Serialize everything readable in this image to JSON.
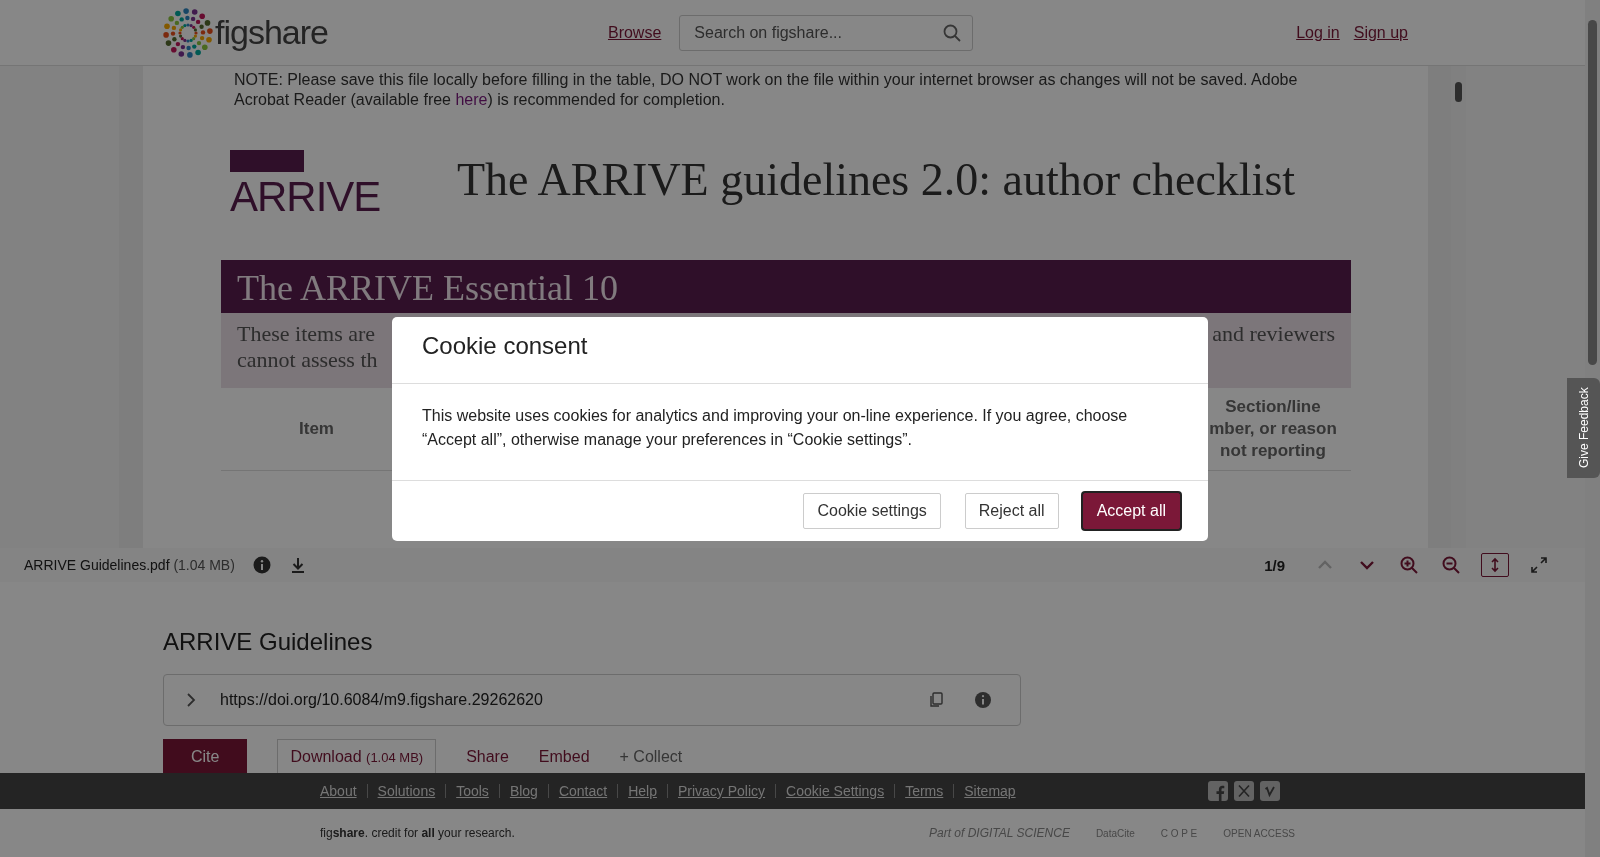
{
  "header": {
    "logo": "figshare",
    "nav_link": "Browse",
    "search": {
      "placeholder": "Search on figshare..."
    },
    "auth_links": [
      "Log in",
      "Sign up"
    ]
  },
  "viewer": {
    "document": {
      "note_before": "NOTE: Please save this file locally before filling in the table, DO NOT work on the file within your internet browser as changes will not be saved. Adobe Acrobat Reader (available free ",
      "note_link": "here",
      "note_after": ") is recommended for completion.",
      "logo": "ARRIVE",
      "title": "The ARRIVE guidelines 2.0: author checklist",
      "banner": "The ARRIVE Essential 10",
      "band_left": "These items are",
      "band_right": "and reviewers",
      "band_line2": "cannot assess th",
      "column_1": "Item",
      "column_last": [
        "Section/line",
        "mber, or reason",
        "not reporting"
      ]
    },
    "toolbar": {
      "file_name": "ARRIVE Guidelines.pdf",
      "file_size": "(1.04 MB)",
      "page": "1/9",
      "controls": [
        {
          "kind": "prev",
          "disabled": true,
          "selected": false
        },
        {
          "kind": "next",
          "disabled": false,
          "selected": false
        },
        {
          "kind": "zoom-in",
          "disabled": false,
          "selected": false
        },
        {
          "kind": "zoom-out",
          "disabled": false,
          "selected": false
        },
        {
          "kind": "fit",
          "disabled": false,
          "selected": true
        },
        {
          "kind": "fullscreen",
          "disabled": false,
          "selected": false
        }
      ]
    }
  },
  "item": {
    "title": "ARRIVE Guidelines",
    "doi": "https://doi.org/10.6084/m9.figshare.29262620",
    "actions": [
      {
        "kind": "primary",
        "label": "Cite"
      },
      {
        "kind": "outline",
        "label": "Download",
        "size": "(1.04 MB)"
      },
      {
        "kind": "link",
        "label": "Share"
      },
      {
        "kind": "link",
        "label": "Embed"
      },
      {
        "kind": "muted",
        "label": "+ Collect"
      }
    ]
  },
  "footer": {
    "links": [
      "About",
      "Solutions",
      "Tools",
      "Blog",
      "Contact",
      "Help",
      "Privacy Policy",
      "Cookie Settings",
      "Terms",
      "Sitemap"
    ],
    "tagline": "fig**share**. credit for **all** your research.",
    "partners": [
      "Part of DIGITAL SCIENCE",
      "DataCite",
      "C O P E",
      "OPEN ACCESS"
    ]
  },
  "feedback_tab": "Give Feedback",
  "cookie_dialog": {
    "title": "Cookie consent",
    "body": "This website uses cookies for analytics and improving your on-line experience. If you agree, choose “Accept all”, otherwise manage your preferences in “Cookie settings”.",
    "buttons": [
      {
        "kind": "secondary",
        "label": "Cookie settings",
        "focused": false
      },
      {
        "kind": "secondary",
        "label": "Reject all",
        "focused": false
      },
      {
        "kind": "primary",
        "label": "Accept all",
        "focused": true
      }
    ]
  }
}
